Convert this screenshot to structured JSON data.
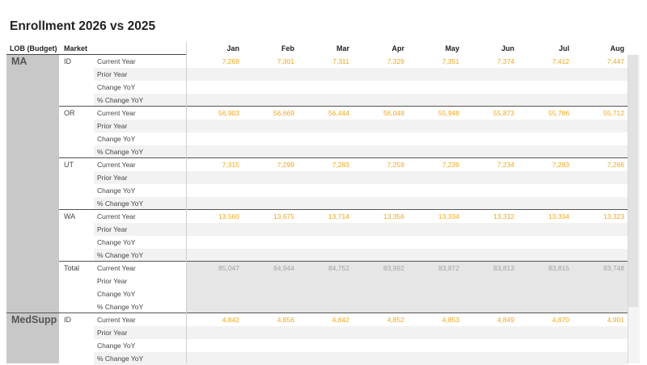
{
  "title": "Enrollment 2026 vs 2025",
  "headers": {
    "lob": "LOB (Budget)",
    "market": "Market"
  },
  "months": [
    "Jan",
    "Feb",
    "Mar",
    "Apr",
    "May",
    "Jun",
    "Jul",
    "Aug"
  ],
  "metrics": [
    "Current Year",
    "Prior Year",
    "Change YoY",
    "% Change YoY"
  ],
  "colors": {
    "current_year_value": "#f0a81e",
    "total_value": "#a3a3a3",
    "lob_band": "#c8c8c8"
  },
  "lobs": [
    {
      "label": "MA",
      "groups": [
        {
          "market": "ID",
          "current_year": [
            "7,269",
            "7,301",
            "7,311",
            "7,329",
            "7,351",
            "7,374",
            "7,412",
            "7,447"
          ]
        },
        {
          "market": "OR",
          "current_year": [
            "56,903",
            "56,669",
            "56,444",
            "56,048",
            "55,948",
            "55,873",
            "55,786",
            "55,712"
          ]
        },
        {
          "market": "UT",
          "current_year": [
            "7,315",
            "7,299",
            "7,283",
            "7,259",
            "7,239",
            "7,234",
            "7,283",
            "7,266"
          ]
        },
        {
          "market": "WA",
          "current_year": [
            "13,560",
            "13,675",
            "13,714",
            "13,356",
            "13,334",
            "13,332",
            "13,334",
            "13,323"
          ]
        },
        {
          "market": "Total",
          "current_year": [
            "85,047",
            "84,944",
            "84,752",
            "83,992",
            "83,872",
            "83,813",
            "83,815",
            "83,748"
          ]
        }
      ]
    },
    {
      "label": "MedSupp",
      "groups": [
        {
          "market": "ID",
          "current_year": [
            "4,842",
            "4,856",
            "4,842",
            "4,852",
            "4,853",
            "4,849",
            "4,870",
            "4,901"
          ]
        }
      ]
    }
  ]
}
